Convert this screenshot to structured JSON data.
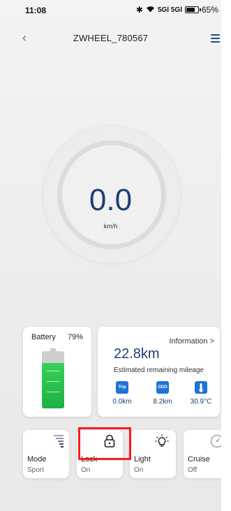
{
  "status_bar": {
    "time": "11:08",
    "signal": "5Gl 5Gl",
    "battery": "65%"
  },
  "header": {
    "title": "ZWHEEL_780567"
  },
  "speed": {
    "value": "0.0",
    "unit": "km/h"
  },
  "battery": {
    "label": "Battery",
    "percent": "79%",
    "level": 0.79
  },
  "info": {
    "link": "Information >",
    "mileage": "22.8km",
    "mileage_label": "Estimated remaining mileage",
    "stats": [
      {
        "icon": "trip-icon",
        "icon_text": "Trip",
        "value": "0.0km"
      },
      {
        "icon": "odo-icon",
        "icon_text": "ODO",
        "value": "8.2km"
      },
      {
        "icon": "thermometer-icon",
        "icon_text": "",
        "value": "30.9°C"
      }
    ]
  },
  "controls": [
    {
      "name": "Mode",
      "value": "Sport",
      "icon": "mode-bars-icon"
    },
    {
      "name": "Lock",
      "value": "On",
      "icon": "lock-icon"
    },
    {
      "name": "Light",
      "value": "On",
      "icon": "light-bulb-icon"
    },
    {
      "name": "Cruise",
      "value": "Off",
      "icon": "speedometer-icon"
    }
  ],
  "colors": {
    "accent": "#1d3f75",
    "icon_blue": "#1f74d6",
    "battery_green": "#2cc44f",
    "highlight": "#ff1a1a"
  }
}
